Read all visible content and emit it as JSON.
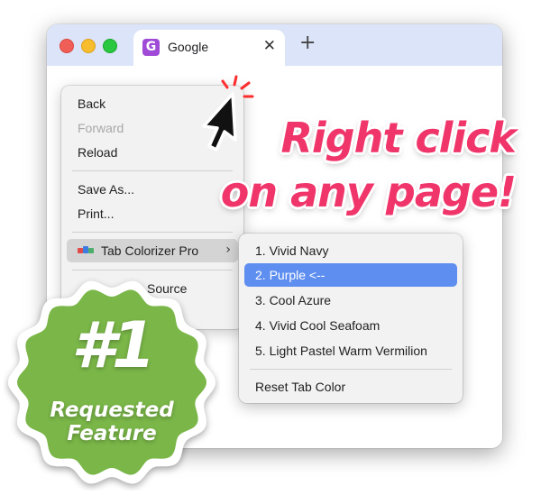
{
  "window": {
    "tab": {
      "icon_letter": "G",
      "title": "Google",
      "close_symbol": "✕"
    },
    "new_tab_symbol": "+"
  },
  "context_menu": {
    "items": [
      {
        "label": "Back",
        "enabled": true
      },
      {
        "label": "Forward",
        "enabled": false
      },
      {
        "label": "Reload",
        "enabled": true
      },
      {
        "label": "Save As...",
        "enabled": true
      },
      {
        "label": "Print...",
        "enabled": true
      },
      {
        "label": "Tab Colorizer Pro",
        "enabled": true,
        "has_submenu": true,
        "highlighted": true
      },
      {
        "label": "Source",
        "enabled": true
      }
    ],
    "submenu_arrow": "›"
  },
  "submenu": {
    "items": [
      {
        "label": "1. Vivid Navy",
        "selected": false
      },
      {
        "label": "2. Purple <--",
        "selected": true
      },
      {
        "label": "3. Cool Azure",
        "selected": false
      },
      {
        "label": "4. Vivid Cool Seafoam",
        "selected": false
      },
      {
        "label": "5. Light Pastel Warm Vermilion",
        "selected": false
      }
    ],
    "reset_label": "Reset Tab Color"
  },
  "headline": {
    "line1": "Right click",
    "line2": "on any page!"
  },
  "badge": {
    "number": "#1",
    "line1": "Requested",
    "line2": "Feature"
  },
  "colors": {
    "titlebar": "#dbe4f8",
    "accent_pink": "#f0356a",
    "selection_blue": "#5e8ef0",
    "badge_green": "#7ab648",
    "tab_icon_purple": "#a04ad8"
  }
}
